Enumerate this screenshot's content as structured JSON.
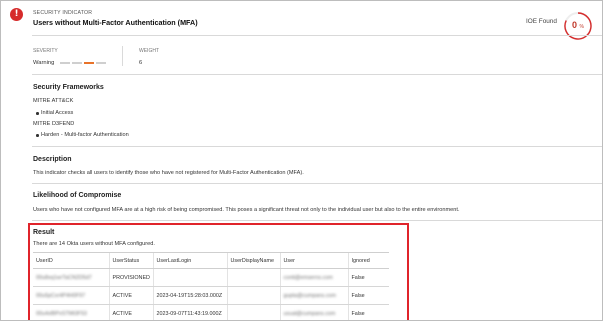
{
  "header": {
    "alert_icon": "exclamation-icon",
    "eyebrow": "SECURITY INDICATOR",
    "title": "Users without Multi-Factor Authentication (MFA)",
    "ioe_label": "IOE Found",
    "score": "0",
    "score_unit": "%"
  },
  "meta": {
    "severity_label": "SEVERITY",
    "severity_value": "Warning",
    "weight_label": "WEIGHT",
    "weight_value": "6"
  },
  "frameworks": {
    "heading": "Security Frameworks",
    "mitre_attack_label": "MITRE ATT&CK",
    "mitre_attack_items": [
      "Initial Access"
    ],
    "mitre_defend_label": "MITRE D3FEND",
    "mitre_defend_items": [
      "Harden - Multi-factor Authentication"
    ]
  },
  "description": {
    "heading": "Description",
    "text": "This indicator checks all users to identify those who have not registered for Multi-Factor Authentication (MFA)."
  },
  "likelihood": {
    "heading": "Likelihood of Compromise",
    "text": "Users who have not configured MFA are at a high risk of being compromised. This poses a significant threat not only to the individual user but also to the entire environment."
  },
  "result": {
    "heading": "Result",
    "summary": "There are 14 Okta users without MFA configured.",
    "columns": [
      "UserID",
      "UserStatus",
      "UserLastLogin",
      "UserDisplayName",
      "User",
      "Ignored"
    ],
    "rows": [
      [
        "00u8xq1wrTaCN2D5d7",
        "PROVISIONED",
        "",
        "",
        "conti@emserns.com",
        "False"
      ],
      [
        "00u5pCxr4P4H0F97",
        "ACTIVE",
        "2023-04-19T15:28:03.000Z",
        "",
        "gupta@cumpans.com",
        "False"
      ],
      [
        "00u4xlBPxSTMt3F53",
        "ACTIVE",
        "2023-09-07T11:43:19.000Z",
        "",
        "usual@cumpans.com",
        "False"
      ]
    ]
  },
  "colors": {
    "alert": "#d62b2b",
    "result_border": "#e0242b",
    "severity_active": "#e8732a",
    "severity_inactive": "#cfcfcf"
  }
}
